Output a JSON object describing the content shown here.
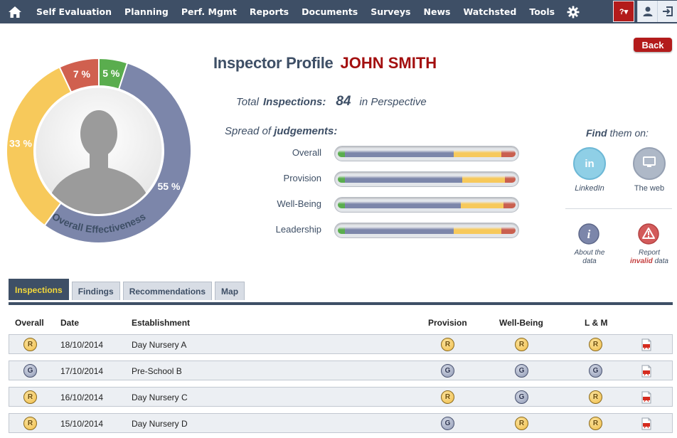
{
  "nav": {
    "items": [
      "Self Evaluation",
      "Planning",
      "Perf. Mgmt",
      "Reports",
      "Documents",
      "Surveys",
      "News",
      "Watchsted",
      "Tools"
    ],
    "help_label": "?▾"
  },
  "back_label": "Back",
  "profile": {
    "title": "Inspector Profile",
    "name": "JOHN SMITH"
  },
  "totals": {
    "prefix": "Total",
    "label": "Inspections:",
    "value": "84",
    "suffix": "in Perspective"
  },
  "spread": {
    "prefix": "Spread of",
    "label": "judgements:",
    "rows": [
      {
        "label": "Overall",
        "green": 4,
        "blue": 61,
        "yellow": 27,
        "red": 8
      },
      {
        "label": "Provision",
        "green": 4,
        "blue": 66,
        "yellow": 24,
        "red": 6
      },
      {
        "label": "Well-Being",
        "green": 4,
        "blue": 65,
        "yellow": 24,
        "red": 7
      },
      {
        "label": "Leadership",
        "green": 4,
        "blue": 61,
        "yellow": 27,
        "red": 8
      }
    ]
  },
  "donut": {
    "segments": [
      {
        "label": "5 %",
        "value": 5,
        "color": "#5aad4e"
      },
      {
        "label": "55 %",
        "value": 55,
        "color": "#7c86aa"
      },
      {
        "label": "33 %",
        "value": 33,
        "color": "#f7c95b"
      },
      {
        "label": "7 %",
        "value": 7,
        "color": "#d0604f"
      }
    ],
    "caption": "Overall Effectiveness"
  },
  "find": {
    "prefix": "Find",
    "label": "them on:",
    "linkedin_label": "LinkedIn",
    "linkedin_glyph": "in",
    "web_label": "The web",
    "about_label_1": "About the",
    "about_label_2": "data",
    "report_label_1": "Report",
    "report_invalid": "invalid",
    "report_label_2": "data"
  },
  "tabs": [
    "Inspections",
    "Findings",
    "Recommendations",
    "Map"
  ],
  "table": {
    "headers": {
      "overall": "Overall",
      "date": "Date",
      "establishment": "Establishment",
      "provision": "Provision",
      "wellbeing": "Well-Being",
      "lm": "L & M"
    },
    "rows": [
      {
        "overall": "R",
        "date": "18/10/2014",
        "establishment": "Day Nursery A",
        "provision": "R",
        "wellbeing": "R",
        "lm": "R"
      },
      {
        "overall": "G",
        "date": "17/10/2014",
        "establishment": "Pre-School B",
        "provision": "G",
        "wellbeing": "G",
        "lm": "G"
      },
      {
        "overall": "R",
        "date": "16/10/2014",
        "establishment": "Day Nursery C",
        "provision": "R",
        "wellbeing": "G",
        "lm": "R"
      },
      {
        "overall": "R",
        "date": "15/10/2014",
        "establishment": "Day Nursery D",
        "provision": "G",
        "wellbeing": "R",
        "lm": "R"
      }
    ]
  },
  "colors": {
    "navbar": "#3e4f66",
    "accent_red": "#a30f0f",
    "tab_active_text": "#f3d83a"
  }
}
